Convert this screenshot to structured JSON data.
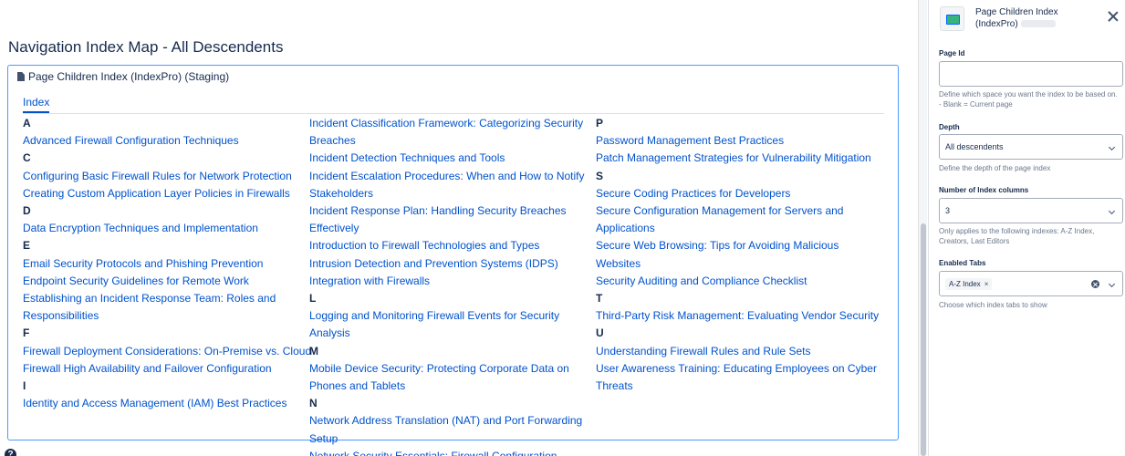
{
  "page": {
    "title": "Navigation Index Map - All Descendents"
  },
  "macro": {
    "header": "Page Children Index (IndexPro) (Staging)",
    "tab": "Index",
    "columns": [
      [
        {
          "type": "letter",
          "text": "A"
        },
        {
          "type": "link",
          "text": "Advanced Firewall Configuration Techniques"
        },
        {
          "type": "letter",
          "text": "C"
        },
        {
          "type": "link",
          "text": "Configuring Basic Firewall Rules for Network Protection"
        },
        {
          "type": "link",
          "text": "Creating Custom Application Layer Policies in Firewalls"
        },
        {
          "type": "letter",
          "text": "D"
        },
        {
          "type": "link",
          "text": "Data Encryption Techniques and Implementation"
        },
        {
          "type": "letter",
          "text": "E"
        },
        {
          "type": "link",
          "text": "Email Security Protocols and Phishing Prevention"
        },
        {
          "type": "link",
          "text": "Endpoint Security Guidelines for Remote Work"
        },
        {
          "type": "link",
          "text": "Establishing an Incident Response Team: Roles and Responsibilities"
        },
        {
          "type": "letter",
          "text": "F"
        },
        {
          "type": "link",
          "text": "Firewall Deployment Considerations: On-Premise vs. Cloud"
        },
        {
          "type": "link",
          "text": "Firewall High Availability and Failover Configuration"
        },
        {
          "type": "letter",
          "text": "I"
        },
        {
          "type": "link",
          "text": "Identity and Access Management (IAM) Best Practices"
        }
      ],
      [
        {
          "type": "link",
          "text": "Incident Classification Framework: Categorizing Security Breaches"
        },
        {
          "type": "link",
          "text": "Incident Detection Techniques and Tools"
        },
        {
          "type": "link",
          "text": "Incident Escalation Procedures: When and How to Notify Stakeholders"
        },
        {
          "type": "link",
          "text": "Incident Response Plan: Handling Security Breaches Effectively"
        },
        {
          "type": "link",
          "text": "Introduction to Firewall Technologies and Types"
        },
        {
          "type": "link",
          "text": "Intrusion Detection and Prevention Systems (IDPS) Integration with Firewalls"
        },
        {
          "type": "letter",
          "text": "L"
        },
        {
          "type": "link",
          "text": "Logging and Monitoring Firewall Events for Security Analysis"
        },
        {
          "type": "letter",
          "text": "M"
        },
        {
          "type": "link",
          "text": "Mobile Device Security: Protecting Corporate Data on Phones and Tablets"
        },
        {
          "type": "letter",
          "text": "N"
        },
        {
          "type": "link",
          "text": "Network Address Translation (NAT) and Port Forwarding Setup"
        },
        {
          "type": "link",
          "text": "Network Security Essentials: Firewall Configuration"
        }
      ],
      [
        {
          "type": "letter",
          "text": "P"
        },
        {
          "type": "link",
          "text": "Password Management Best Practices"
        },
        {
          "type": "link",
          "text": "Patch Management Strategies for Vulnerability Mitigation"
        },
        {
          "type": "letter",
          "text": "S"
        },
        {
          "type": "link",
          "text": "Secure Coding Practices for Developers"
        },
        {
          "type": "link",
          "text": "Secure Configuration Management for Servers and Applications"
        },
        {
          "type": "link",
          "text": "Secure Web Browsing: Tips for Avoiding Malicious Websites"
        },
        {
          "type": "link",
          "text": "Security Auditing and Compliance Checklist"
        },
        {
          "type": "letter",
          "text": "T"
        },
        {
          "type": "link",
          "text": "Third-Party Risk Management: Evaluating Vendor Security"
        },
        {
          "type": "letter",
          "text": "U"
        },
        {
          "type": "link",
          "text": "Understanding Firewall Rules and Rule Sets"
        },
        {
          "type": "link",
          "text": "User Awareness Training: Educating Employees on Cyber Threats"
        }
      ]
    ]
  },
  "panel": {
    "title": "Page Children Index (IndexPro)",
    "page_id": {
      "label": "Page Id",
      "value": "",
      "help": "Define which space you want the index to be based on. - Blank = Current page"
    },
    "depth": {
      "label": "Depth",
      "value": "All descendents",
      "help": "Define the depth of the page index"
    },
    "columns": {
      "label": "Number of Index columns",
      "value": "3",
      "help": "Only applies to the following indexes: A-Z Index, Creators, Last Editors"
    },
    "tabs": {
      "label": "Enabled Tabs",
      "chip": "A-Z Index",
      "chip_remove": "×",
      "help": "Choose which index tabs to show"
    }
  },
  "help_icon": "?"
}
